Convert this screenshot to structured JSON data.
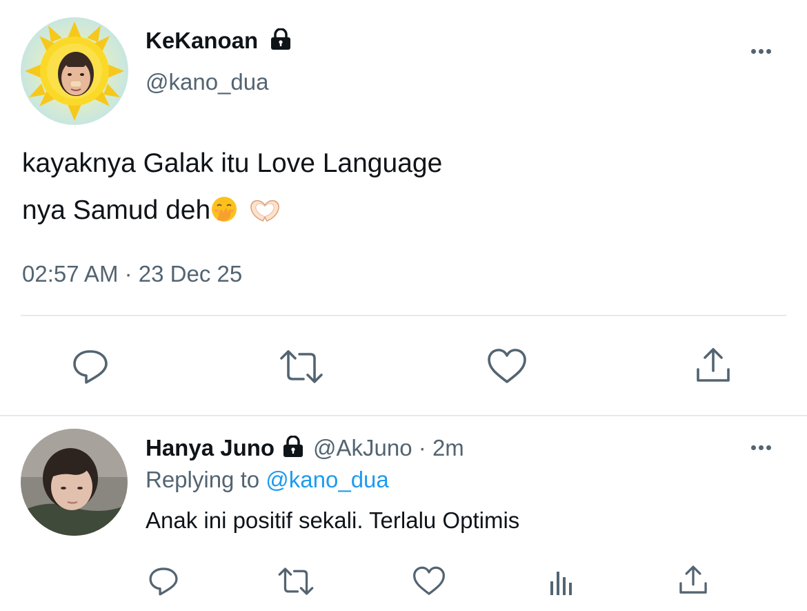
{
  "tweet": {
    "display_name": "KeKanoan",
    "handle": "@kano_dua",
    "text_line1": "kayaknya Galak itu Love Language",
    "text_line2": "nya Samud deh",
    "timestamp": "02:57 AM · 23 Dec 25",
    "avatar": "sun-face-avatar",
    "protected_icon": "lock-icon",
    "emojis": [
      "hand-over-mouth-emoji",
      "heart-hands-emoji"
    ],
    "actions": [
      "reply-icon",
      "retweet-icon",
      "like-icon",
      "share-icon"
    ]
  },
  "reply": {
    "display_name": "Hanya Juno",
    "meta": "@AkJuno · 2m",
    "replying_prefix": "Replying to",
    "replying_to": "@kano_dua",
    "text": "Anak ini positif sekali. Terlalu Optimis",
    "avatar": "person-photo-avatar",
    "protected_icon": "lock-icon",
    "actions": [
      "reply-icon",
      "retweet-icon",
      "like-icon",
      "analytics-icon",
      "share-icon"
    ]
  },
  "colors": {
    "text": "#0f1419",
    "secondary": "#536471",
    "link": "#1d9bf0",
    "divider": "#e6e9ec"
  }
}
